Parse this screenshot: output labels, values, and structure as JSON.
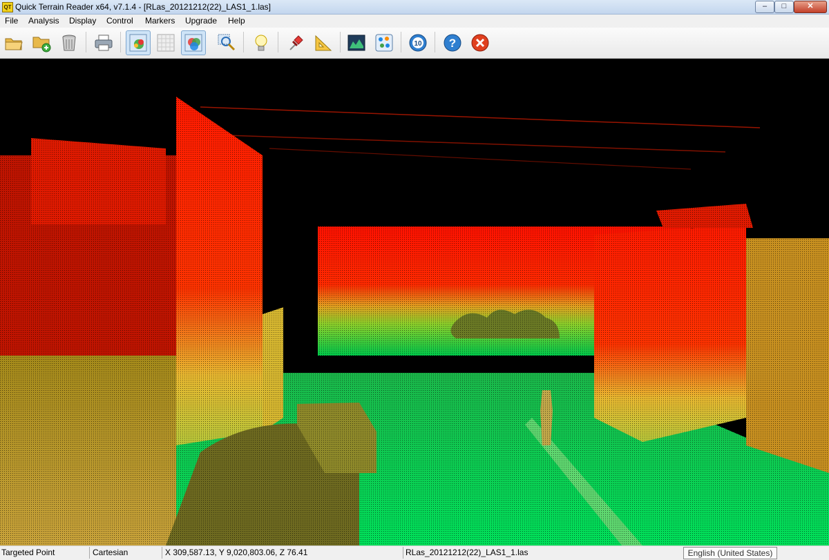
{
  "window": {
    "icon_text": "QT",
    "title": "Quick Terrain Reader x64, v7.1.4 - [RLas_20121212(22)_LAS1_1.las]",
    "min_glyph": "–",
    "max_glyph": "□",
    "close_glyph": "✕"
  },
  "menu": [
    "File",
    "Analysis",
    "Display",
    "Control",
    "Markers",
    "Upgrade",
    "Help"
  ],
  "toolbar": [
    {
      "icon": "open-folder-icon"
    },
    {
      "icon": "add-folder-icon"
    },
    {
      "icon": "trash-icon"
    },
    {
      "icon": "print-icon"
    },
    {
      "icon": "color-by-height-icon"
    },
    {
      "icon": "grid-texture-icon"
    },
    {
      "icon": "rgb-color-icon"
    },
    {
      "icon": "zoom-select-icon"
    },
    {
      "icon": "lightbulb-icon"
    },
    {
      "icon": "pushpin-icon"
    },
    {
      "icon": "measure-triangle-icon"
    },
    {
      "icon": "profile-icon"
    },
    {
      "icon": "point-cloud-icon"
    },
    {
      "icon": "rotate-ten-icon",
      "label": "10"
    },
    {
      "icon": "help-icon",
      "label": "?"
    },
    {
      "icon": "close-red-icon"
    }
  ],
  "colors": {
    "terrain_low": "#00c94a",
    "terrain_mid": "#d8c21c",
    "terrain_high": "#ff1200"
  },
  "status": {
    "mode": "Targeted Point",
    "coord_system": "Cartesian",
    "coordinates": "X 309,587.13, Y 9,020,803.06, Z 76.41",
    "file": "RLas_20121212(22)_LAS1_1.las",
    "language": "English (United States)"
  }
}
